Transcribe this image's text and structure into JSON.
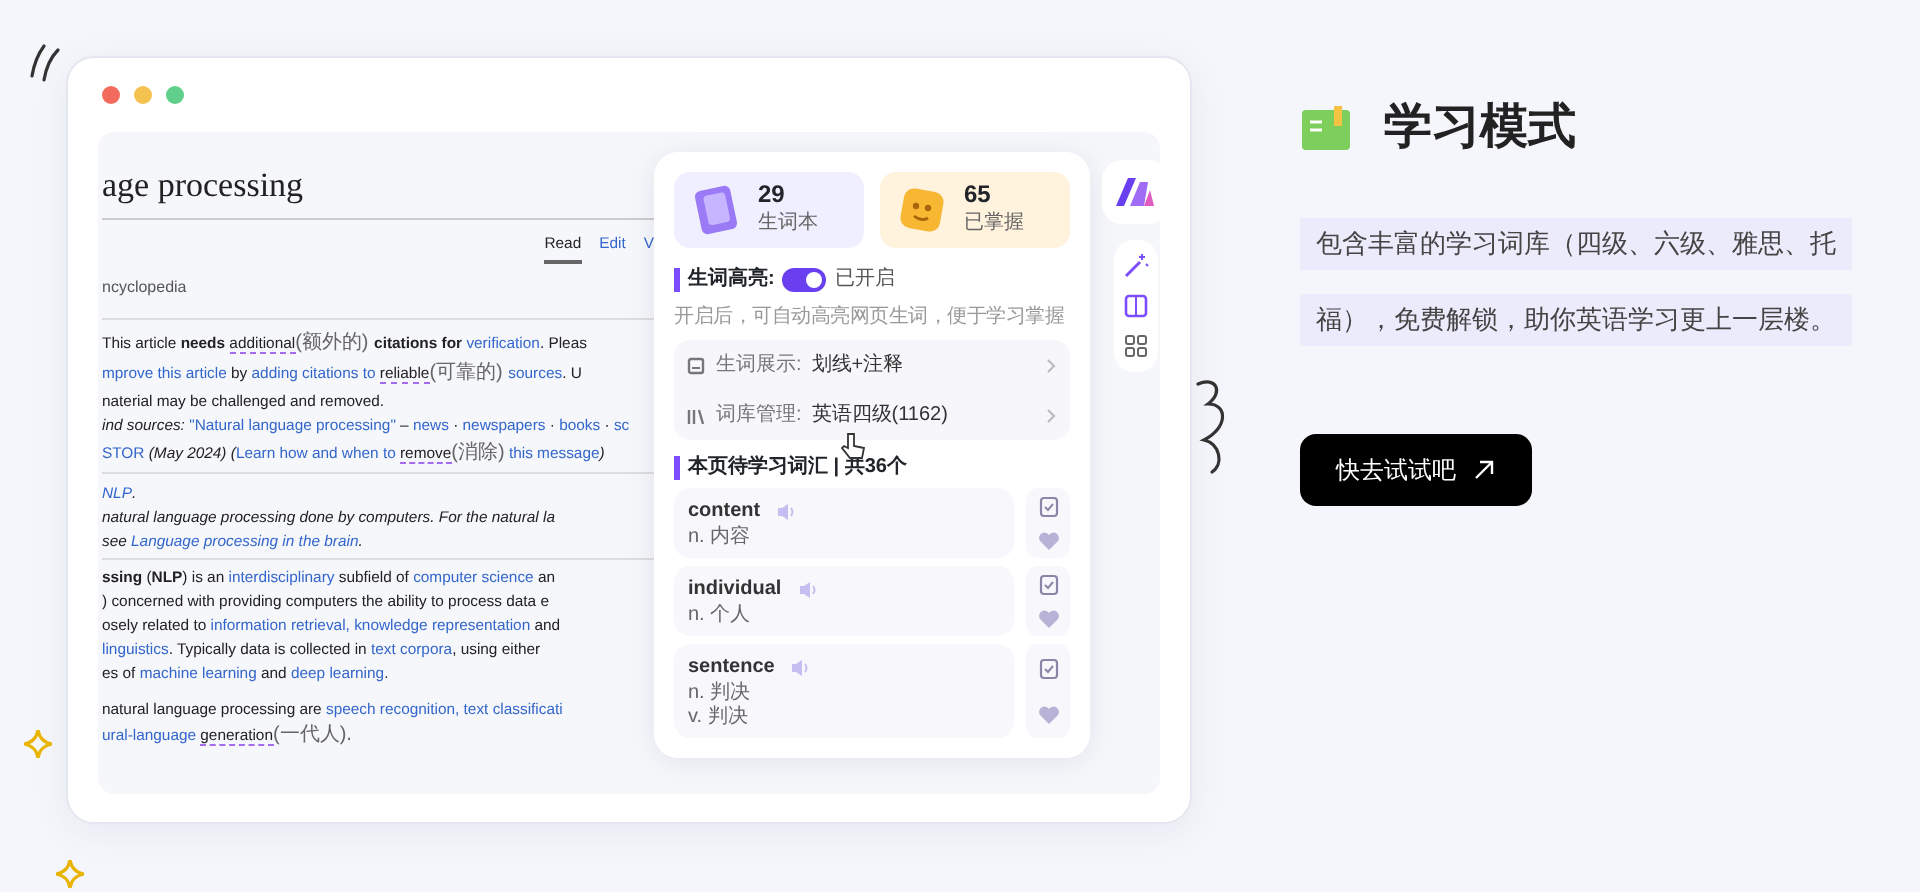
{
  "article": {
    "title": "age processing",
    "tabs": [
      {
        "label": "Read",
        "selected": true
      },
      {
        "label": "Edit",
        "selected": false
      },
      {
        "label": "V",
        "selected": false
      }
    ],
    "tagline": "ncyclopedia",
    "notice": [
      [
        {
          "text": "This article ",
          "kind": "text"
        },
        {
          "text": "needs ",
          "kind": "bold"
        },
        {
          "text": "additional",
          "kind": "gloss"
        },
        {
          "text": "(额外的) ",
          "kind": "note"
        },
        {
          "text": "citations for ",
          "kind": "bold"
        },
        {
          "text": "verification",
          "kind": "link"
        },
        {
          "text": ". Pleas",
          "kind": "text"
        }
      ],
      [
        {
          "text": "mprove this article",
          "kind": "link"
        },
        {
          "text": " by ",
          "kind": "text"
        },
        {
          "text": "adding citations to ",
          "kind": "link"
        },
        {
          "text": "reliable",
          "kind": "gloss"
        },
        {
          "text": "(可靠的) ",
          "kind": "note"
        },
        {
          "text": "sources",
          "kind": "link"
        },
        {
          "text": ". U",
          "kind": "text"
        }
      ],
      [
        {
          "text": "naterial may be challenged and removed.",
          "kind": "text"
        }
      ],
      [
        {
          "text": "ind sources: ",
          "kind": "italic"
        },
        {
          "text": "\"Natural language processing\"",
          "kind": "link"
        },
        {
          "text": " – ",
          "kind": "text"
        },
        {
          "text": "news",
          "kind": "link"
        },
        {
          "text": " · ",
          "kind": "text"
        },
        {
          "text": "newspapers",
          "kind": "link"
        },
        {
          "text": " · ",
          "kind": "text"
        },
        {
          "text": "books",
          "kind": "link"
        },
        {
          "text": " · ",
          "kind": "text"
        },
        {
          "text": "sc",
          "kind": "link"
        }
      ],
      [
        {
          "text": "STOR",
          "kind": "link"
        },
        {
          "text": " (May 2024) (",
          "kind": "italic"
        },
        {
          "text": "Learn how and when to ",
          "kind": "link"
        },
        {
          "text": "remove",
          "kind": "gloss"
        },
        {
          "text": "(消除)",
          "kind": "note"
        },
        {
          "text": " this message",
          "kind": "link"
        },
        {
          "text": ")",
          "kind": "italic"
        }
      ]
    ],
    "hatnote": [
      [
        {
          "text": "NLP",
          "kind": "link"
        },
        {
          "text": ".",
          "kind": "text"
        }
      ],
      [
        {
          "text": "natural language processing done by computers. For the natural la",
          "kind": "text"
        }
      ],
      [
        {
          "text": "see ",
          "kind": "text"
        },
        {
          "text": "Language processing in the brain",
          "kind": "link"
        },
        {
          "text": ".",
          "kind": "text"
        }
      ]
    ],
    "paragraphs": [
      [
        [
          {
            "text": "ssing",
            "kind": "bold"
          },
          {
            "text": " (",
            "kind": "text"
          },
          {
            "text": "NLP",
            "kind": "bold"
          },
          {
            "text": ") is an ",
            "kind": "text"
          },
          {
            "text": "interdisciplinary",
            "kind": "link"
          },
          {
            "text": " subfield of ",
            "kind": "text"
          },
          {
            "text": "computer science",
            "kind": "link"
          },
          {
            "text": " an",
            "kind": "text"
          }
        ],
        [
          {
            "text": ") concerned with providing computers the ability to process data e",
            "kind": "text"
          }
        ],
        [
          {
            "text": "osely related to ",
            "kind": "text"
          },
          {
            "text": "information retrieval,",
            "kind": "link"
          },
          {
            "text": " knowledge representation",
            "kind": "link"
          },
          {
            "text": " and",
            "kind": "text"
          }
        ],
        [
          {
            "text": "linguistics",
            "kind": "link"
          },
          {
            "text": ". Typically data is collected in ",
            "kind": "text"
          },
          {
            "text": "text corpora",
            "kind": "link"
          },
          {
            "text": ", using either",
            "kind": "text"
          }
        ],
        [
          {
            "text": "es of ",
            "kind": "text"
          },
          {
            "text": "machine learning",
            "kind": "link"
          },
          {
            "text": " and ",
            "kind": "text"
          },
          {
            "text": "deep learning",
            "kind": "link"
          },
          {
            "text": ".",
            "kind": "text"
          }
        ]
      ],
      [
        [
          {
            "text": "natural language processing are ",
            "kind": "text"
          },
          {
            "text": "speech recognition,",
            "kind": "link"
          },
          {
            "text": " text classificati",
            "kind": "link"
          }
        ],
        [
          {
            "text": "ural-language ",
            "kind": "link"
          },
          {
            "text": "generation",
            "kind": "gloss"
          },
          {
            "text": "(一代人).",
            "kind": "note"
          }
        ]
      ]
    ]
  },
  "panel": {
    "stats": [
      {
        "value": "29",
        "label": "生词本",
        "kind": "wordbook"
      },
      {
        "value": "65",
        "label": "已掌握",
        "kind": "mastered"
      }
    ],
    "highlight": {
      "label": "生词高亮:",
      "on": true,
      "status": "已开启",
      "description": "开启后，可自动高亮网页生词，便于学习掌握"
    },
    "settings": [
      {
        "label": "生词展示:",
        "value": "划线+注释",
        "kind": "display"
      },
      {
        "label": "词库管理:",
        "value": "英语四级(1162)",
        "kind": "library"
      }
    ],
    "words_title": "本页待学习词汇 | 共36个",
    "words": [
      {
        "word": "content",
        "meanings": [
          "n. 内容"
        ]
      },
      {
        "word": "individual",
        "meanings": [
          "n. 个人"
        ]
      },
      {
        "word": "sentence",
        "meanings": [
          "n. 判决",
          "v. 判决"
        ]
      }
    ]
  },
  "promo": {
    "title": "学习模式",
    "description": [
      "包含丰富的学习词库（四级、六级、雅思、托",
      "福），免费解锁，助你英语学习更上一层楼。"
    ],
    "button": "快去试试吧"
  }
}
